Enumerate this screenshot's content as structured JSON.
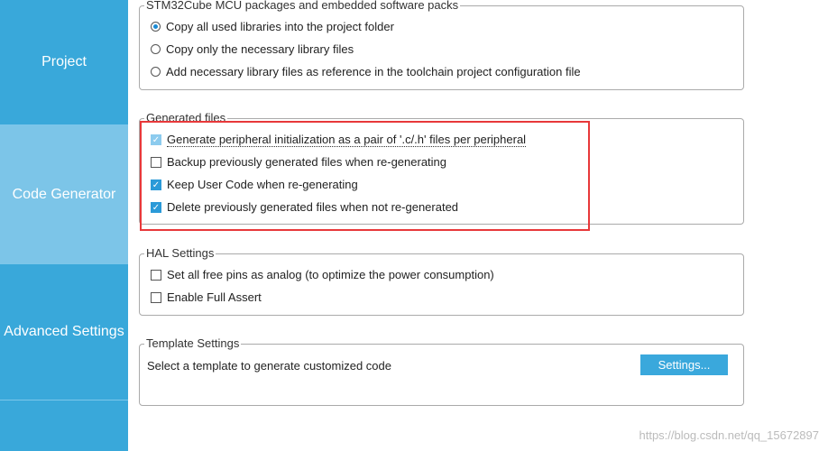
{
  "sidebar": {
    "tabs": [
      {
        "label": "Project"
      },
      {
        "label": "Code Generator",
        "active": true
      },
      {
        "label": "Advanced Settings"
      }
    ]
  },
  "packs": {
    "title": "STM32Cube MCU packages and embedded software packs",
    "options": [
      {
        "label": "Copy all used libraries into the project folder",
        "selected": true
      },
      {
        "label": "Copy only the necessary library files",
        "selected": false
      },
      {
        "label": "Add necessary library files as reference in the toolchain project configuration file",
        "selected": false
      }
    ]
  },
  "generated": {
    "title": "Generated files",
    "options": [
      {
        "label": "Generate peripheral initialization as a pair of '.c/.h' files per peripheral",
        "checked": true,
        "disabled": true
      },
      {
        "label": "Backup previously generated files when re-generating",
        "checked": false
      },
      {
        "label": "Keep User Code when re-generating",
        "checked": true
      },
      {
        "label": "Delete previously generated files when not re-generated",
        "checked": true
      }
    ]
  },
  "hal": {
    "title": "HAL Settings",
    "options": [
      {
        "label": "Set all free pins as analog (to optimize the power consumption)",
        "checked": false
      },
      {
        "label": "Enable Full Assert",
        "checked": false
      }
    ]
  },
  "template": {
    "title": "Template Settings",
    "text": "Select a template to generate customized code",
    "button": "Settings..."
  },
  "watermark": "https://blog.csdn.net/qq_15672897",
  "colors": {
    "accent": "#39a8da",
    "active_tab": "#7cc5e8",
    "highlight": "#e8383a"
  }
}
